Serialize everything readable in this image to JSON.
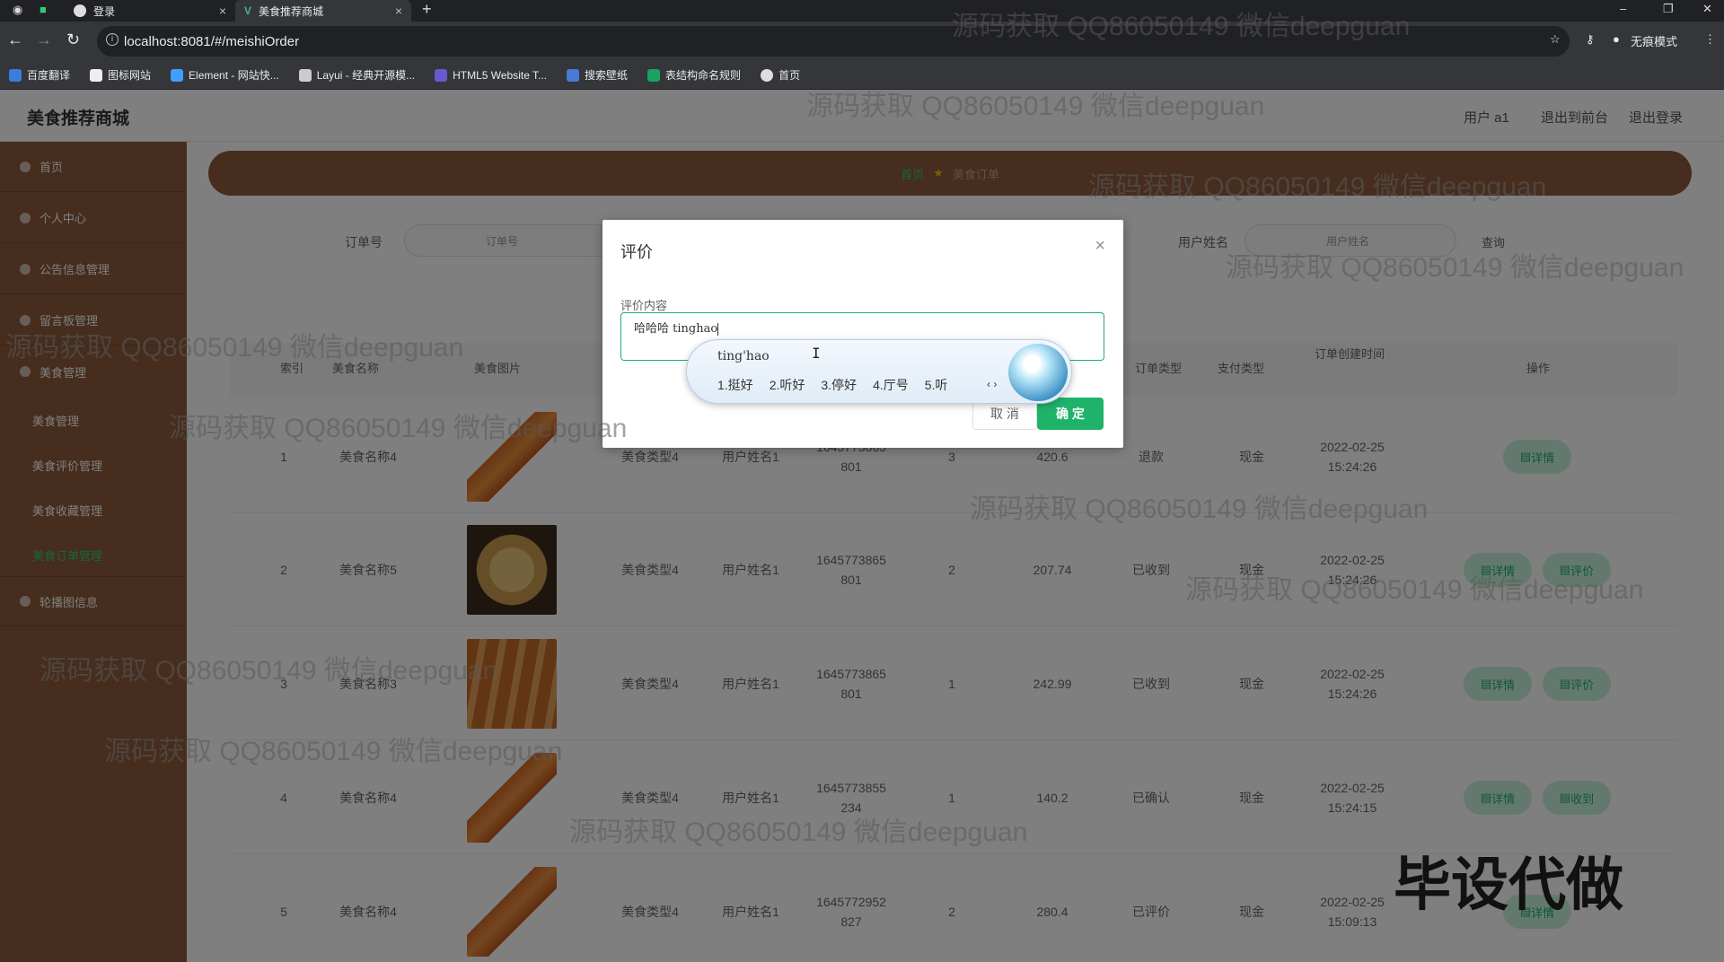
{
  "browser": {
    "tabs": [
      {
        "title": "登录",
        "icon": "globe-icon"
      },
      {
        "title": "美食推荐商城",
        "icon": "vue-icon"
      }
    ],
    "url": "localhost:8081/#/meishiOrder",
    "profile": "无痕模式",
    "bookmarks": [
      "百度翻译",
      "图标网站",
      "Element - 网站快...",
      "Layui - 经典开源模...",
      "HTML5 Website T...",
      "搜索壁纸",
      "表结构命名规则",
      "首页"
    ]
  },
  "app": {
    "brand": "美食推荐商城",
    "header_links": [
      "用户 a1",
      "退出到前台",
      "退出登录"
    ],
    "sidebar": {
      "items": [
        "首页",
        "个人中心",
        "公告信息管理",
        "留言板管理",
        "美食管理",
        "轮播图信息"
      ],
      "sub_items": [
        "美食管理",
        "美食评价管理",
        "美食收藏管理",
        "美食订单管理"
      ]
    },
    "breadcrumb": {
      "home": "首页",
      "current": "美食订单"
    },
    "search": {
      "order_label": "订单号",
      "order_placeholder": "订单号",
      "user_label": "用户姓名",
      "user_placeholder": "用户姓名",
      "query_button": "查询"
    },
    "table": {
      "headers": [
        "索引",
        "美食名称",
        "美食图片",
        "订单类型",
        "支付类型",
        "订单创建时间",
        "操作"
      ],
      "rows": [
        {
          "index": "1",
          "name": "美食名称4",
          "type": "美食类型4",
          "user": "用户姓名1",
          "order_no": "1645773865\n801",
          "qty": "3",
          "price": "420.6",
          "status": "退款",
          "pay": "现金",
          "time": "2022-02-25\n15:24:26",
          "actions": [
            "详情"
          ]
        },
        {
          "index": "2",
          "name": "美食名称5",
          "type": "美食类型4",
          "user": "用户姓名1",
          "order_no": "1645773865\n801",
          "qty": "2",
          "price": "207.74",
          "status": "已收到",
          "pay": "现金",
          "time": "2022-02-25\n15:24:26",
          "actions": [
            "详情",
            "评价"
          ]
        },
        {
          "index": "3",
          "name": "美食名称3",
          "type": "美食类型4",
          "user": "用户姓名1",
          "order_no": "1645773865\n801",
          "qty": "1",
          "price": "242.99",
          "status": "已收到",
          "pay": "现金",
          "time": "2022-02-25\n15:24:26",
          "actions": [
            "详情",
            "评价"
          ]
        },
        {
          "index": "4",
          "name": "美食名称4",
          "type": "美食类型4",
          "user": "用户姓名1",
          "order_no": "1645773855\n234",
          "qty": "1",
          "price": "140.2",
          "status": "已确认",
          "pay": "现金",
          "time": "2022-02-25\n15:24:15",
          "actions": [
            "详情",
            "收到"
          ]
        },
        {
          "index": "5",
          "name": "美食名称4",
          "type": "美食类型4",
          "user": "用户姓名1",
          "order_no": "1645772952\n827",
          "qty": "2",
          "price": "280.4",
          "status": "已评价",
          "pay": "现金",
          "time": "2022-02-25\n15:09:13",
          "actions": [
            "详情"
          ]
        }
      ]
    }
  },
  "dialog": {
    "title": "评价",
    "field_label": "评价内容",
    "content": "哈哈哈 tinghao",
    "cancel": "取 消",
    "confirm": "确 定"
  },
  "ime": {
    "pinyin": "ting'hao",
    "candidates": [
      "1.挺好",
      "2.听好",
      "3.停好",
      "4.厅号",
      "5.听"
    ],
    "arrows": "‹ ›"
  },
  "watermark": "源码获取 QQ86050149 微信deepguan",
  "corner_text": "毕设代做",
  "colors": {
    "brown": "#8d5b3d",
    "green": "#1fb36a"
  }
}
